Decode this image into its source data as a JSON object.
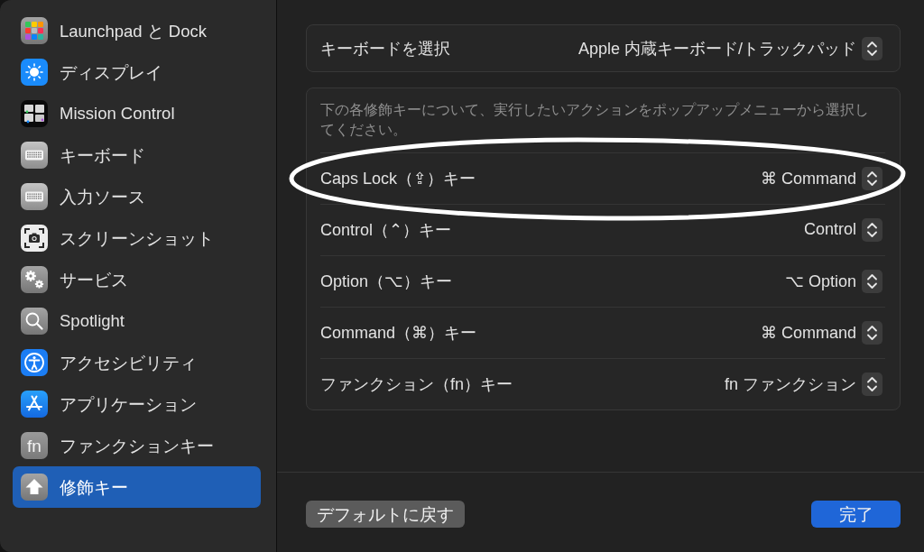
{
  "sidebar": {
    "items": [
      {
        "label": "Launchpad と Dock",
        "selected": false
      },
      {
        "label": "ディスプレイ",
        "selected": false
      },
      {
        "label": "Mission Control",
        "selected": false
      },
      {
        "label": "キーボード",
        "selected": false
      },
      {
        "label": "入力ソース",
        "selected": false
      },
      {
        "label": "スクリーンショット",
        "selected": false
      },
      {
        "label": "サービス",
        "selected": false
      },
      {
        "label": "Spotlight",
        "selected": false
      },
      {
        "label": "アクセシビリティ",
        "selected": false
      },
      {
        "label": "アプリケーション",
        "selected": false
      },
      {
        "label": "ファンクションキー",
        "selected": false,
        "icon_text": "fn"
      },
      {
        "label": "修飾キー",
        "selected": true
      }
    ]
  },
  "sheet": {
    "keyboard": {
      "label": "キーボードを選択",
      "value": "Apple 内蔵キーボード/トラックパッド"
    },
    "description": "下の各修飾キーについて、実行したいアクションをポップアップメニューから選択してください。",
    "modifiers": [
      {
        "label": "Caps Lock（⇪）キー",
        "value": "⌘ Command",
        "circled": true
      },
      {
        "label": "Control（⌃）キー",
        "value": "Control",
        "circled": false
      },
      {
        "label": "Option（⌥）キー",
        "value": "⌥ Option",
        "circled": false
      },
      {
        "label": "Command（⌘）キー",
        "value": "⌘ Command",
        "circled": false
      },
      {
        "label": "ファンクション（fn）キー",
        "value": "fn ファンクション",
        "circled": false
      }
    ],
    "buttons": [
      {
        "label": "デフォルトに戻す",
        "kind": "secondary"
      },
      {
        "label": "完了",
        "kind": "primary"
      }
    ]
  }
}
